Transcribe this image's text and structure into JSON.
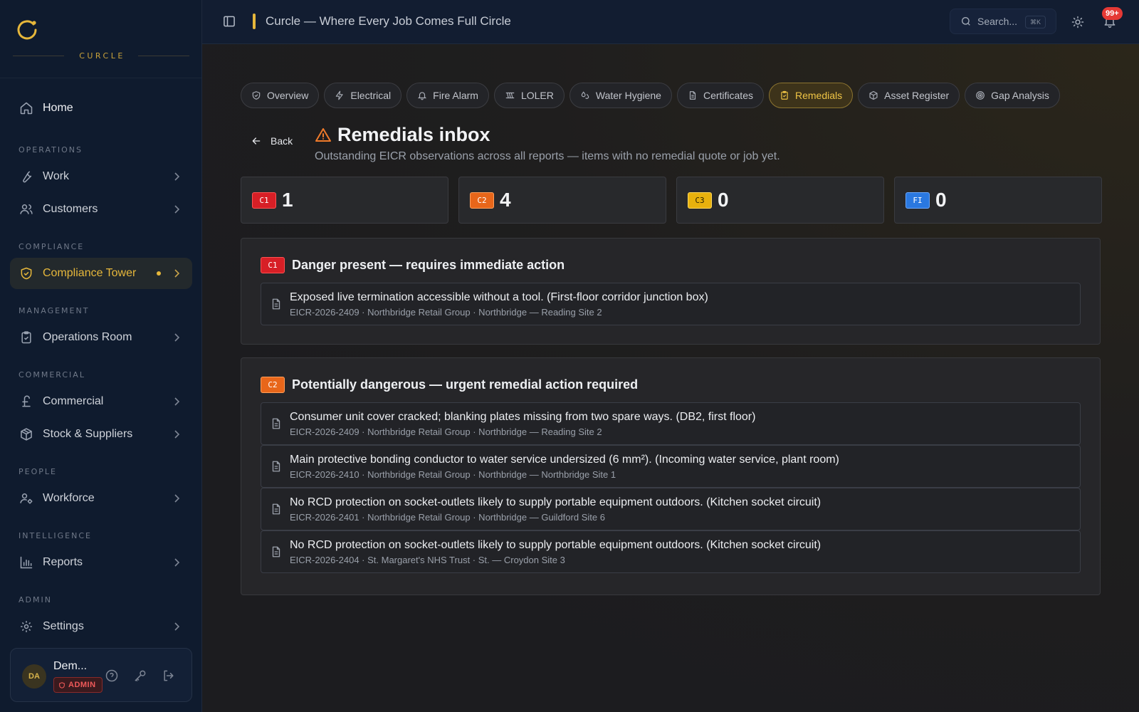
{
  "brand": {
    "name": "CURCLE",
    "accent": "#e6b73b"
  },
  "sidebar": {
    "home": "Home",
    "sections": [
      {
        "label": "OPERATIONS",
        "items": [
          "Work",
          "Customers"
        ]
      },
      {
        "label": "COMPLIANCE",
        "items": [
          "Compliance Tower"
        ]
      },
      {
        "label": "MANAGEMENT",
        "items": [
          "Operations Room"
        ]
      },
      {
        "label": "COMMERCIAL",
        "items": [
          "Commercial",
          "Stock & Suppliers"
        ]
      },
      {
        "label": "PEOPLE",
        "items": [
          "Workforce"
        ]
      },
      {
        "label": "INTELLIGENCE",
        "items": [
          "Reports"
        ]
      },
      {
        "label": "ADMIN",
        "items": [
          "Settings"
        ]
      }
    ],
    "user": {
      "initials": "DA",
      "name": "Dem...",
      "role": "ADMIN"
    }
  },
  "topbar": {
    "title": "Curcle — Where Every Job Comes Full Circle",
    "search_placeholder": "Search...",
    "search_shortcut": "⌘K",
    "notifications": "99+"
  },
  "tabs": [
    {
      "label": "Overview",
      "icon": "shield-icon"
    },
    {
      "label": "Electrical",
      "icon": "zap-icon"
    },
    {
      "label": "Fire Alarm",
      "icon": "bell-icon"
    },
    {
      "label": "LOLER",
      "icon": "lift-icon"
    },
    {
      "label": "Water Hygiene",
      "icon": "droplets-icon"
    },
    {
      "label": "Certificates",
      "icon": "file-icon"
    },
    {
      "label": "Remedials",
      "icon": "clipboard-icon",
      "active": true
    },
    {
      "label": "Asset Register",
      "icon": "package-icon"
    },
    {
      "label": "Gap Analysis",
      "icon": "target-icon"
    }
  ],
  "page": {
    "back": "Back",
    "title": "Remedials inbox",
    "subtitle": "Outstanding EICR observations across all reports — items with no remedial quote or job yet."
  },
  "stats": [
    {
      "code": "C1",
      "value": "1",
      "color": "#d71f26"
    },
    {
      "code": "C2",
      "value": "4",
      "color": "#e8661a"
    },
    {
      "code": "C3",
      "value": "0",
      "color": "#e8b10d"
    },
    {
      "code": "FI",
      "value": "0",
      "color": "#2a78e0"
    }
  ],
  "groups": [
    {
      "code": "C1",
      "title": "Danger present — requires immediate action",
      "items": [
        {
          "text": "Exposed live termination accessible without a tool. (First-floor corridor junction box)",
          "meta": "EICR-2026-2409 · Northbridge Retail Group · Northbridge — Reading Site 2"
        }
      ]
    },
    {
      "code": "C2",
      "title": "Potentially dangerous — urgent remedial action required",
      "items": [
        {
          "text": "Consumer unit cover cracked; blanking plates missing from two spare ways. (DB2, first floor)",
          "meta": "EICR-2026-2409 · Northbridge Retail Group · Northbridge — Reading Site 2"
        },
        {
          "text": "Main protective bonding conductor to water service undersized (6 mm²). (Incoming water service, plant room)",
          "meta": "EICR-2026-2410 · Northbridge Retail Group · Northbridge — Northbridge Site 1"
        },
        {
          "text": "No RCD protection on socket-outlets likely to supply portable equipment outdoors. (Kitchen socket circuit)",
          "meta": "EICR-2026-2401 · Northbridge Retail Group · Northbridge — Guildford Site 6"
        },
        {
          "text": "No RCD protection on socket-outlets likely to supply portable equipment outdoors. (Kitchen socket circuit)",
          "meta": "EICR-2026-2404 · St. Margaret's NHS Trust · St. — Croydon Site 3"
        }
      ]
    }
  ]
}
